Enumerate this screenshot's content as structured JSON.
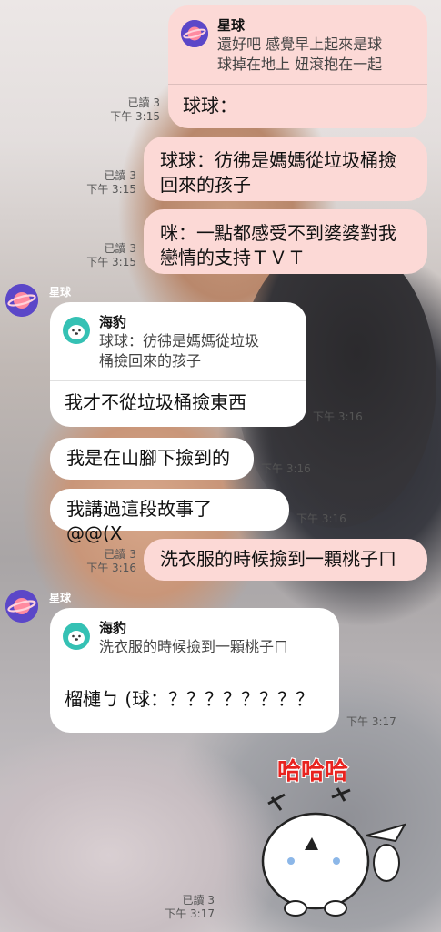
{
  "colors": {
    "my_bubble": "#fcd9d6",
    "their_bubble": "#ffffff",
    "planet_avatar": "#6a4fd0",
    "seal_avatar": "#35c1b4",
    "sticker_text": "#e8231f"
  },
  "icons": {
    "planet": "planet-icon",
    "seal": "seal-icon"
  },
  "messages": [
    {
      "quote_name": "星球",
      "quote_text": "還好吧 感覺早上起來是球\n球掉在地上 妞滾抱在一起",
      "text": "球球：",
      "read": "已讀 3",
      "time": "下午 3:15"
    },
    {
      "text": "球球：彷彿是媽媽從垃圾桶撿\n回來的孩子",
      "read": "已讀 3",
      "time": "下午 3:15"
    },
    {
      "text": "咪：一點都感受不到婆婆對我\n戀情的支持ＴＶＴ",
      "read": "已讀 3",
      "time": "下午 3:15"
    },
    {
      "sender": "星球",
      "quote_name": "海豹",
      "quote_text": "球球：彷彿是媽媽從垃圾\n桶撿回來的孩子",
      "text": "我才不從垃圾桶撿東西",
      "time": "下午 3:16"
    },
    {
      "text": "我是在山腳下撿到的",
      "time": "下午 3:16"
    },
    {
      "text": "我講過這段故事了 @@(X",
      "time": "下午 3:16"
    },
    {
      "text": "洗衣服的時候撿到一顆桃子ㄇ",
      "read": "已讀 3",
      "time": "下午 3:16"
    },
    {
      "sender": "星球",
      "quote_name": "海豹",
      "quote_text": "洗衣服的時候撿到一顆桃子ㄇ",
      "text": "榴槤ㄅ (球：？？？？？？？？",
      "time": "下午 3:17"
    },
    {
      "sticker_text": "哈哈哈",
      "read": "已讀 3",
      "time": "下午 3:17"
    }
  ]
}
